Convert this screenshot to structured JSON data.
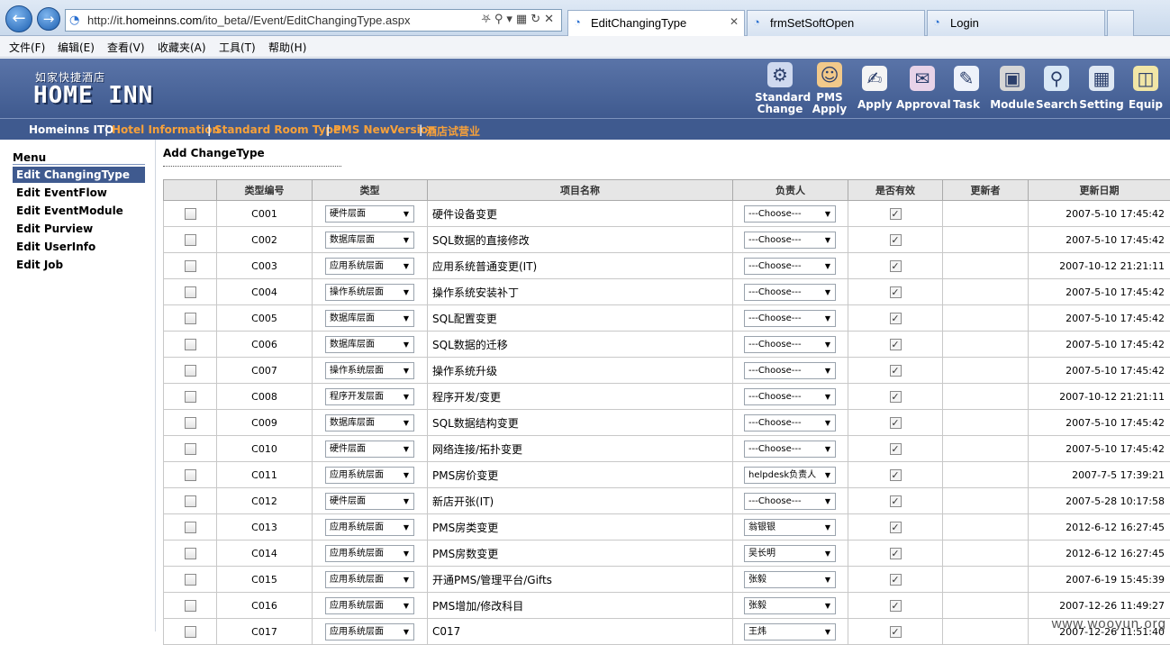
{
  "browser": {
    "url_prefix": "http://it.",
    "url_host": "homeinns.com",
    "url_suffix": "/ito_beta//Event/EditChangingType.aspx",
    "tabs": [
      {
        "label": "EditChangingType",
        "active": true
      },
      {
        "label": "frmSetSoftOpen",
        "active": false
      },
      {
        "label": "Login",
        "active": false
      }
    ]
  },
  "menubar": [
    "文件(F)",
    "编辑(E)",
    "查看(V)",
    "收藏夹(A)",
    "工具(T)",
    "帮助(H)"
  ],
  "logo": {
    "cn": "如家快捷酒店",
    "en": "HOME INN"
  },
  "header_nav": [
    {
      "label1": "Standard",
      "label2": "Change",
      "icon": "gear-icon"
    },
    {
      "label1": "PMS",
      "label2": "Apply",
      "icon": "people-icon"
    },
    {
      "label1": "Apply",
      "label2": "",
      "icon": "hand-document-icon"
    },
    {
      "label1": "Approval",
      "label2": "",
      "icon": "approval-icon"
    },
    {
      "label1": "Task",
      "label2": "",
      "icon": "task-icon"
    },
    {
      "label1": "Module",
      "label2": "",
      "icon": "chip-icon"
    },
    {
      "label1": "Search",
      "label2": "",
      "icon": "magnifier-icon"
    },
    {
      "label1": "Setting",
      "label2": "",
      "icon": "setting-icon"
    },
    {
      "label1": "Equip",
      "label2": "",
      "icon": "equipment-icon"
    }
  ],
  "subnav": [
    {
      "label": "Homeinns ITO",
      "color": "#ffffff"
    },
    {
      "label": "Hotel Information",
      "color": "#f7a13a"
    },
    {
      "label": "Standard Room Type",
      "color": "#f7a13a"
    },
    {
      "label": "PMS NewVersion",
      "color": "#f7a13a"
    },
    {
      "label": "酒店试营业",
      "color": "#f7a13a"
    }
  ],
  "sidebar": {
    "title": "Menu",
    "items": [
      {
        "label": "Edit ChangingType",
        "active": true
      },
      {
        "label": "Edit EventFlow",
        "active": false
      },
      {
        "label": "Edit EventModule",
        "active": false
      },
      {
        "label": "Edit Purview",
        "active": false
      },
      {
        "label": "Edit UserInfo",
        "active": false
      },
      {
        "label": "Edit Job",
        "active": false
      }
    ]
  },
  "main": {
    "title": "Add ChangeType",
    "columns": [
      "",
      "类型编号",
      "类型",
      "项目名称",
      "负责人",
      "是否有效",
      "更新者",
      "更新日期"
    ],
    "rows": [
      {
        "code": "C001",
        "type": "硬件层面",
        "name": "硬件设备变更",
        "owner": "---Choose---",
        "valid": true,
        "updater": "",
        "date": "2007-5-10 17:45:42"
      },
      {
        "code": "C002",
        "type": "数据库层面",
        "name": "SQL数据的直接修改",
        "owner": "---Choose---",
        "valid": true,
        "updater": "",
        "date": "2007-5-10 17:45:42"
      },
      {
        "code": "C003",
        "type": "应用系统层面",
        "name": "应用系统普通变更(IT)",
        "owner": "---Choose---",
        "valid": true,
        "updater": "",
        "date": "2007-10-12 21:21:11"
      },
      {
        "code": "C004",
        "type": "操作系统层面",
        "name": "操作系统安装补丁",
        "owner": "---Choose---",
        "valid": true,
        "updater": "",
        "date": "2007-5-10 17:45:42"
      },
      {
        "code": "C005",
        "type": "数据库层面",
        "name": "SQL配置变更",
        "owner": "---Choose---",
        "valid": true,
        "updater": "",
        "date": "2007-5-10 17:45:42"
      },
      {
        "code": "C006",
        "type": "数据库层面",
        "name": "SQL数据的迁移",
        "owner": "---Choose---",
        "valid": true,
        "updater": "",
        "date": "2007-5-10 17:45:42"
      },
      {
        "code": "C007",
        "type": "操作系统层面",
        "name": "操作系统升级",
        "owner": "---Choose---",
        "valid": true,
        "updater": "",
        "date": "2007-5-10 17:45:42"
      },
      {
        "code": "C008",
        "type": "程序开发层面",
        "name": "程序开发/变更",
        "owner": "---Choose---",
        "valid": true,
        "updater": "",
        "date": "2007-10-12 21:21:11"
      },
      {
        "code": "C009",
        "type": "数据库层面",
        "name": "SQL数据结构变更",
        "owner": "---Choose---",
        "valid": true,
        "updater": "",
        "date": "2007-5-10 17:45:42"
      },
      {
        "code": "C010",
        "type": "硬件层面",
        "name": "网络连接/拓扑变更",
        "owner": "---Choose---",
        "valid": true,
        "updater": "",
        "date": "2007-5-10 17:45:42"
      },
      {
        "code": "C011",
        "type": "应用系统层面",
        "name": "PMS房价变更",
        "owner": "helpdesk负责人",
        "valid": true,
        "updater": "",
        "date": "2007-7-5 17:39:21"
      },
      {
        "code": "C012",
        "type": "硬件层面",
        "name": "新店开张(IT)",
        "owner": "---Choose---",
        "valid": true,
        "updater": "",
        "date": "2007-5-28 10:17:58"
      },
      {
        "code": "C013",
        "type": "应用系统层面",
        "name": "PMS房类变更",
        "owner": "翁银银",
        "valid": true,
        "updater": "",
        "date": "2012-6-12 16:27:45"
      },
      {
        "code": "C014",
        "type": "应用系统层面",
        "name": "PMS房数变更",
        "owner": "吴长明",
        "valid": true,
        "updater": "",
        "date": "2012-6-12 16:27:45"
      },
      {
        "code": "C015",
        "type": "应用系统层面",
        "name": "开通PMS/管理平台/Gifts",
        "owner": "张毅",
        "valid": true,
        "updater": "",
        "date": "2007-6-19 15:45:39"
      },
      {
        "code": "C016",
        "type": "应用系统层面",
        "name": "PMS增加/修改科目",
        "owner": "张毅",
        "valid": true,
        "updater": "",
        "date": "2007-12-26 11:49:27"
      },
      {
        "code": "C017",
        "type": "应用系统层面",
        "name": "C017",
        "owner": "王炜",
        "valid": true,
        "updater": "",
        "date": "2007-12-26 11:51:40"
      }
    ]
  },
  "watermark": "www.wooyun.org"
}
